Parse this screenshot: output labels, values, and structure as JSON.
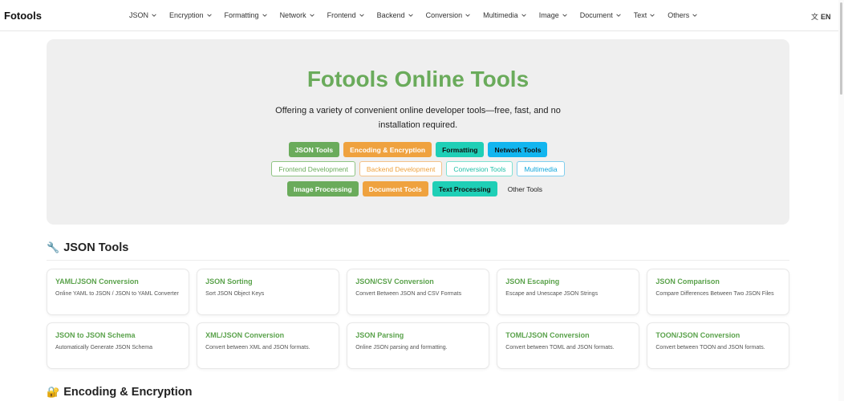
{
  "nav": {
    "brand": "Fotools",
    "items": [
      {
        "label": "JSON"
      },
      {
        "label": "Encryption"
      },
      {
        "label": "Formatting"
      },
      {
        "label": "Network"
      },
      {
        "label": "Frontend"
      },
      {
        "label": "Backend"
      },
      {
        "label": "Conversion"
      },
      {
        "label": "Multimedia"
      },
      {
        "label": "Image"
      },
      {
        "label": "Document"
      },
      {
        "label": "Text"
      },
      {
        "label": "Others"
      }
    ],
    "language": "EN",
    "language_icon": "translate-icon"
  },
  "hero": {
    "title": "Fotools Online Tools",
    "subtitle": "Offering a variety of convenient online developer tools—free, fast, and no installation required.",
    "title_color": "#6aab5b",
    "tags": [
      {
        "label": "JSON Tools",
        "style": "solid-green"
      },
      {
        "label": "Encoding & Encryption",
        "style": "solid-orange"
      },
      {
        "label": "Formatting",
        "style": "solid-teal"
      },
      {
        "label": "Network Tools",
        "style": "solid-blue"
      },
      {
        "label": "Frontend Development",
        "style": "outline-green"
      },
      {
        "label": "Backend Development",
        "style": "outline-orange"
      },
      {
        "label": "Conversion Tools",
        "style": "outline-teal"
      },
      {
        "label": "Multimedia",
        "style": "outline-blue"
      },
      {
        "label": "Image Processing",
        "style": "solid-green"
      },
      {
        "label": "Document Tools",
        "style": "solid-orange"
      },
      {
        "label": "Text Processing",
        "style": "solid-teal"
      },
      {
        "label": "Other Tools",
        "style": "plain"
      }
    ]
  },
  "sections": {
    "json": {
      "icon": "wrench-icon",
      "title": "JSON Tools",
      "cards": [
        {
          "title": "YAML/JSON Conversion",
          "desc": "Online YAML to JSON / JSON to YAML Converter"
        },
        {
          "title": "JSON Sorting",
          "desc": "Sort JSON Object Keys"
        },
        {
          "title": "JSON/CSV Conversion",
          "desc": "Convert Between JSON and CSV Formats"
        },
        {
          "title": "JSON Escaping",
          "desc": "Escape and Unescape JSON Strings"
        },
        {
          "title": "JSON Comparison",
          "desc": "Compare Differences Between Two JSON Files"
        },
        {
          "title": "JSON to JSON Schema",
          "desc": "Automatically Generate JSON Schema"
        },
        {
          "title": "XML/JSON Conversion",
          "desc": "Convert between XML and JSON formats."
        },
        {
          "title": "JSON Parsing",
          "desc": "Online JSON parsing and formatting."
        },
        {
          "title": "TOML/JSON Conversion",
          "desc": "Convert between TOML and JSON formats."
        },
        {
          "title": "TOON/JSON Conversion",
          "desc": "Convert between TOON and JSON formats."
        }
      ]
    },
    "encoding": {
      "icon": "lock-with-key-icon",
      "title": "Encoding & Encryption"
    }
  }
}
